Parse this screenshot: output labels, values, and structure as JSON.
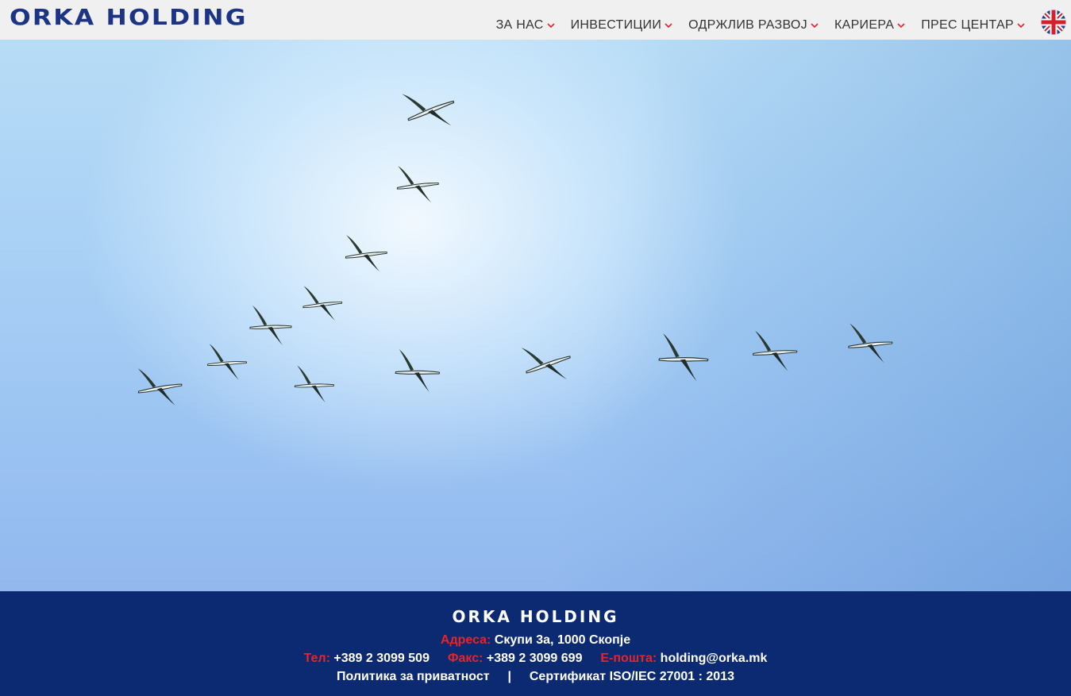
{
  "header": {
    "logo": "ORKA HOLDING",
    "nav": [
      {
        "label": "ЗА НАС"
      },
      {
        "label": "ИНВЕСТИЦИИ"
      },
      {
        "label": "ОДРЖЛИВ РАЗВОЈ"
      },
      {
        "label": "КАРИЕРА"
      },
      {
        "label": "ПРЕС ЦЕНТАР"
      }
    ],
    "language_icon": "uk-flag-icon"
  },
  "hero": {
    "image": "sky-with-flock-of-storks"
  },
  "footer": {
    "logo": "ORKA HOLDING",
    "address_label": "Адреса:",
    "address": "Скупи 3а, 1000 Скопје",
    "phone_label": "Тел:",
    "phone": "+389 2 3099 509",
    "fax_label": "Факс:",
    "fax": "+389 2 3099 699",
    "email_label": "Е-пошта:",
    "email": "holding@orka.mk",
    "privacy_link": "Политика за приватност",
    "separator": "|",
    "certificate_link": "Сертификат ISO/IEC 27001 : 2013"
  },
  "colors": {
    "brand_blue": "#1c3486",
    "footer_bg": "#0c2a72",
    "accent_red": "#e8232a"
  }
}
